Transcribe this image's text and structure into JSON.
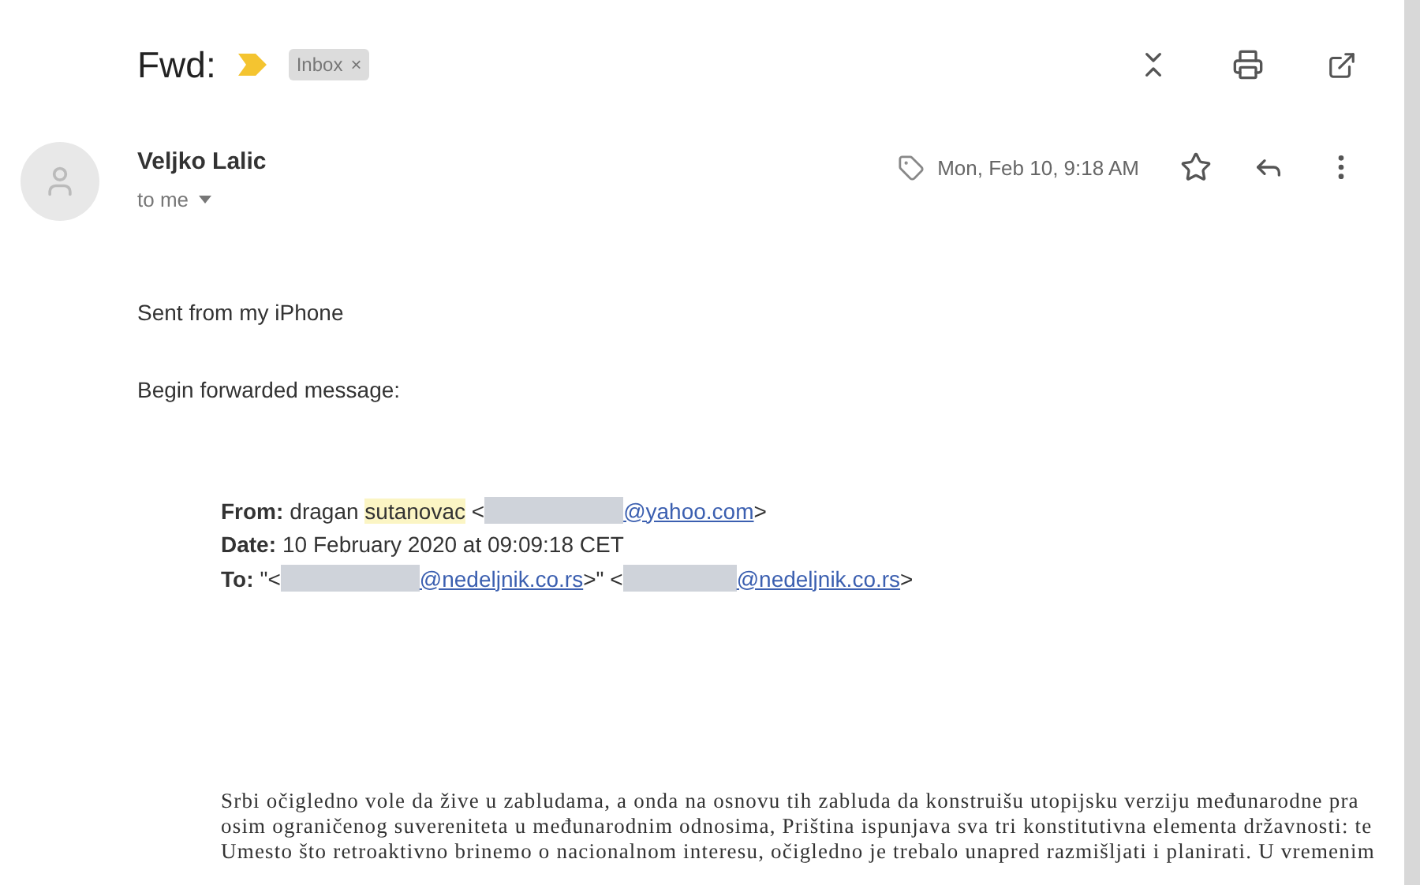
{
  "subject": {
    "title": "Fwd:",
    "important": true,
    "labels": [
      {
        "text": "Inbox",
        "remove": "×"
      }
    ]
  },
  "message": {
    "sender": "Veljko Lalic",
    "recipient": "to me",
    "date": "Mon, Feb 10, 9:18 AM",
    "starred": false
  },
  "body": {
    "paragraphs": [
      "Sent from my iPhone",
      "Begin forwarded message:"
    ],
    "forwarded": [
      {
        "kind": "from",
        "label": "From:",
        "name": "dragan",
        "highlighted_name": "sutanovac",
        "open": "<",
        "domain": "@yahoo.com",
        "close": ">"
      },
      {
        "kind": "date",
        "label": "Date:",
        "value": "10 February 2020 at 09:09:18 CET"
      },
      {
        "kind": "to",
        "label": "To:",
        "open": "\"<",
        "domain": "@nedeljnik.co.rs",
        "close": ">\"",
        "open_2": "<",
        "domain_2": "@nedeljnik.co.rs",
        "close_2": ">"
      }
    ],
    "article_lines": [
      "Srbi očigledno vole da žive u zabludama, a onda na osnovu tih zabluda da konstruišu utopijsku verziju međunarodne pra",
      "osim ograničenog suvereniteta u međunarodnim odnosima, Priština ispunjava sva tri konstitutivna elementa državnosti: te",
      "Umesto što retroaktivno brinemo o nacionalnom interesu, očigledno je trebalo unapred razmišljati i planirati. U vremenim"
    ]
  }
}
